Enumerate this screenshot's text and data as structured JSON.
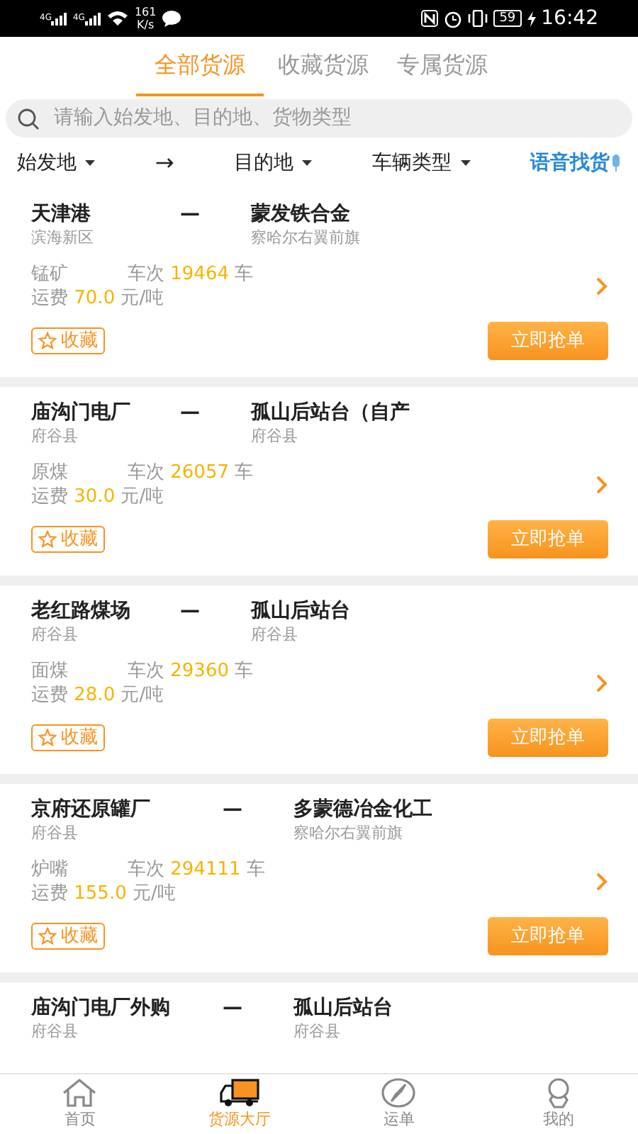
{
  "status_bar": {
    "networks": [
      "4G",
      "4G"
    ],
    "speed": "161",
    "speed_unit": "K/s",
    "battery": "59",
    "time": "16:42"
  },
  "tabs": [
    {
      "label": "全部货源",
      "selected": true
    },
    {
      "label": "收藏货源",
      "selected": false
    },
    {
      "label": "专属货源",
      "selected": false
    }
  ],
  "search": {
    "placeholder": "请输入始发地、目的地、货物类型"
  },
  "filters": {
    "origin": "始发地",
    "arrow": "→",
    "destination": "目的地",
    "vehicle_type": "车辆类型",
    "voice_search": "语音找货"
  },
  "cards": [
    {
      "from": "天津港",
      "dash": "—",
      "to": "蒙发铁合金",
      "from_area": "滨海新区",
      "to_area": "察哈尔右翼前旗",
      "cargo": "锰矿",
      "trips_label": "车次",
      "trips": "19464",
      "trips_unit": "车",
      "fee_label": "运费",
      "fee": "70.0",
      "fee_unit": "元/吨",
      "favorite_label": "收藏",
      "favorited": false,
      "grab_label": "立即抢单"
    },
    {
      "from": "庙沟门电厂",
      "dash": "—",
      "to": "孤山后站台（自产",
      "from_area": "府谷县",
      "to_area": "府谷县",
      "cargo": "原煤",
      "trips_label": "车次",
      "trips": "26057",
      "trips_unit": "车",
      "fee_label": "运费",
      "fee": "30.0",
      "fee_unit": "元/吨",
      "favorite_label": "收藏",
      "favorited": false,
      "grab_label": "立即抢单"
    },
    {
      "from": "老红路煤场",
      "dash": "—",
      "to": "孤山后站台",
      "from_area": "府谷县",
      "to_area": "府谷县",
      "cargo": "面煤",
      "trips_label": "车次",
      "trips": "29360",
      "trips_unit": "车",
      "fee_label": "运费",
      "fee": "28.0",
      "fee_unit": "元/吨",
      "favorite_label": "收藏",
      "favorited": false,
      "grab_label": "立即抢单"
    },
    {
      "from": "京府还原罐厂",
      "dash": "—",
      "to": "多蒙德冶金化工",
      "from_area": "府谷县",
      "to_area": "察哈尔右翼前旗",
      "cargo": "炉嘴",
      "trips_label": "车次",
      "trips": "294111",
      "trips_unit": "车",
      "fee_label": "运费",
      "fee": "155.0",
      "fee_unit": "元/吨",
      "favorite_label": "收藏",
      "favorited": false,
      "grab_label": "立即抢单"
    },
    {
      "from": "庙沟门电厂外购",
      "dash": "—",
      "to": "孤山后站台",
      "from_area": "府谷县",
      "to_area": "府谷县"
    }
  ],
  "bottom_nav": [
    {
      "label": "首页",
      "selected": false
    },
    {
      "label": "货源大厅",
      "selected": true
    },
    {
      "label": "运单",
      "selected": false
    },
    {
      "label": "我的",
      "selected": false
    }
  ]
}
